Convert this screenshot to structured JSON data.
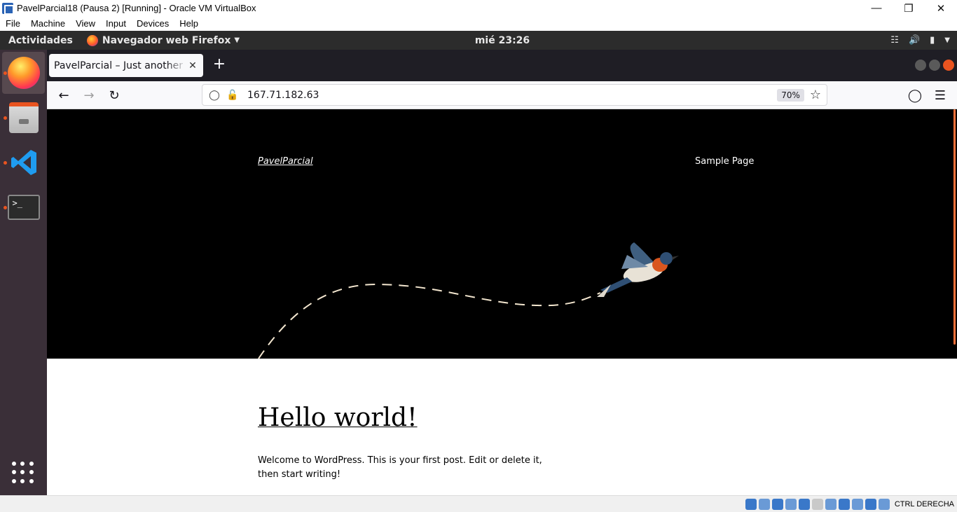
{
  "vbox": {
    "title": "PavelParcial18 (Pausa 2) [Running] - Oracle VM VirtualBox",
    "menu": [
      "File",
      "Machine",
      "View",
      "Input",
      "Devices",
      "Help"
    ],
    "host_key": "CTRL DERECHA"
  },
  "gnome": {
    "activities": "Actividades",
    "app_menu": "Navegador web Firefox",
    "clock": "mié 23:26"
  },
  "dock": {
    "items": [
      "firefox-icon",
      "files-icon",
      "vscode-icon",
      "terminal-icon",
      "show-apps-icon"
    ]
  },
  "firefox": {
    "tab_title": "PavelParcial – Just another WordPress site",
    "url": "167.71.182.63",
    "zoom": "70%"
  },
  "page": {
    "site_title": "PavelParcial",
    "nav_item": "Sample Page",
    "post_title": "Hello world!",
    "post_body": "Welcome to WordPress. This is your first post. Edit or delete it, then start writing!"
  },
  "colors": {
    "ubuntu_orange": "#e95420",
    "dock_bg": "#3a2f38",
    "hero_bg": "#000000"
  }
}
